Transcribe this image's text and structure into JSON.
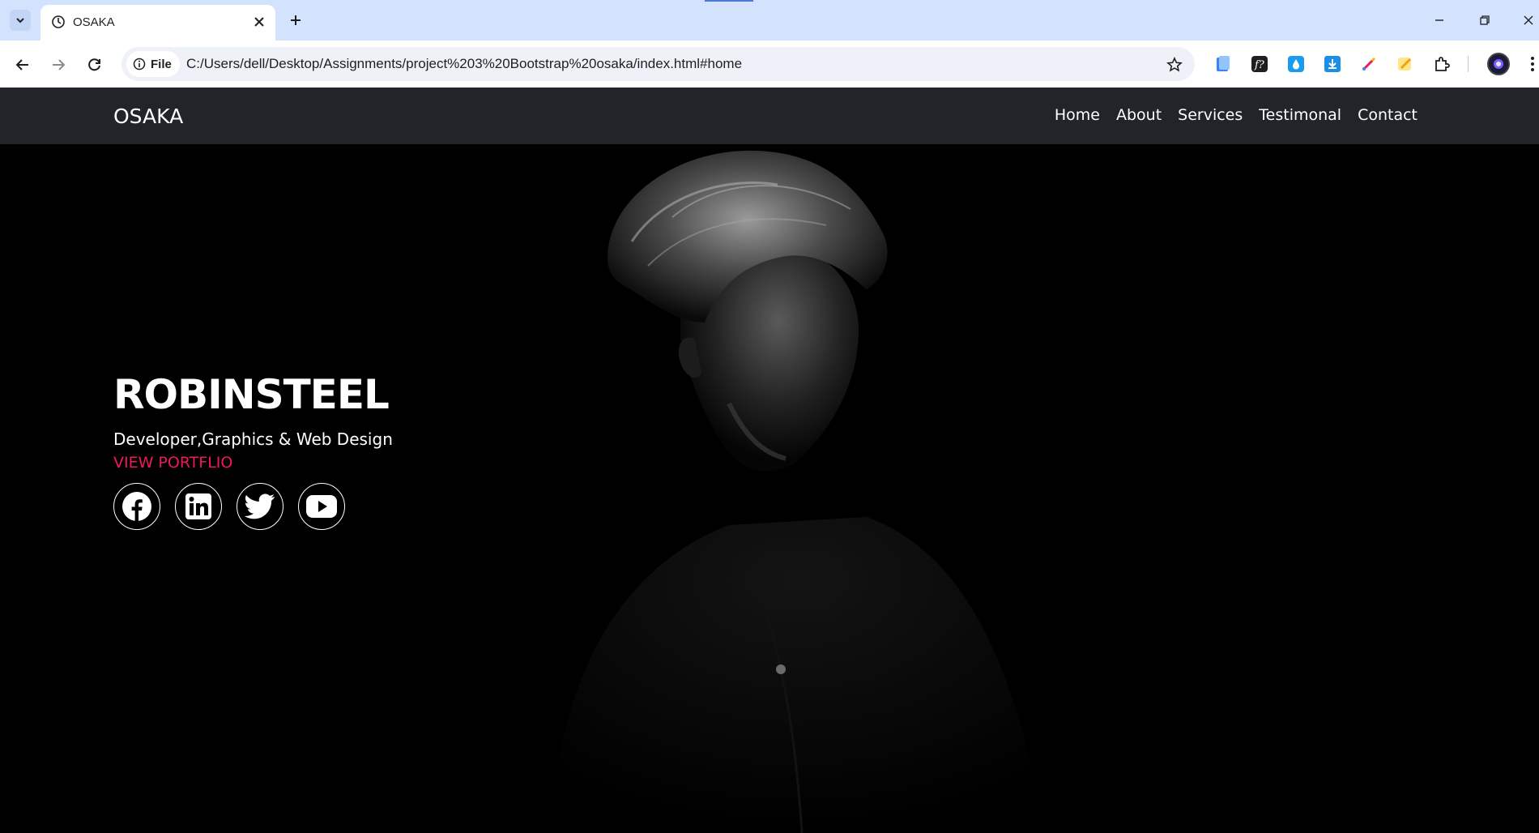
{
  "browser": {
    "tab_title": "OSAKA",
    "file_chip_label": "File",
    "url": "C:/Users/dell/Desktop/Assignments/project%203%20Bootstrap%20osaka/index.html#home"
  },
  "site": {
    "brand": "OSAKA",
    "nav": [
      "Home",
      "About",
      "Services",
      "Testimonal",
      "Contact"
    ]
  },
  "hero": {
    "name": "ROBINSTEEL",
    "tagline": "Developer,Graphics & Web Design",
    "cta": "VIEW PORTFLIO",
    "socials": [
      "facebook-icon",
      "linkedin-icon",
      "twitter-icon",
      "youtube-icon"
    ]
  },
  "colors": {
    "navbar_bg": "#212529",
    "accent": "#f0185a",
    "page_bg": "#000000"
  }
}
